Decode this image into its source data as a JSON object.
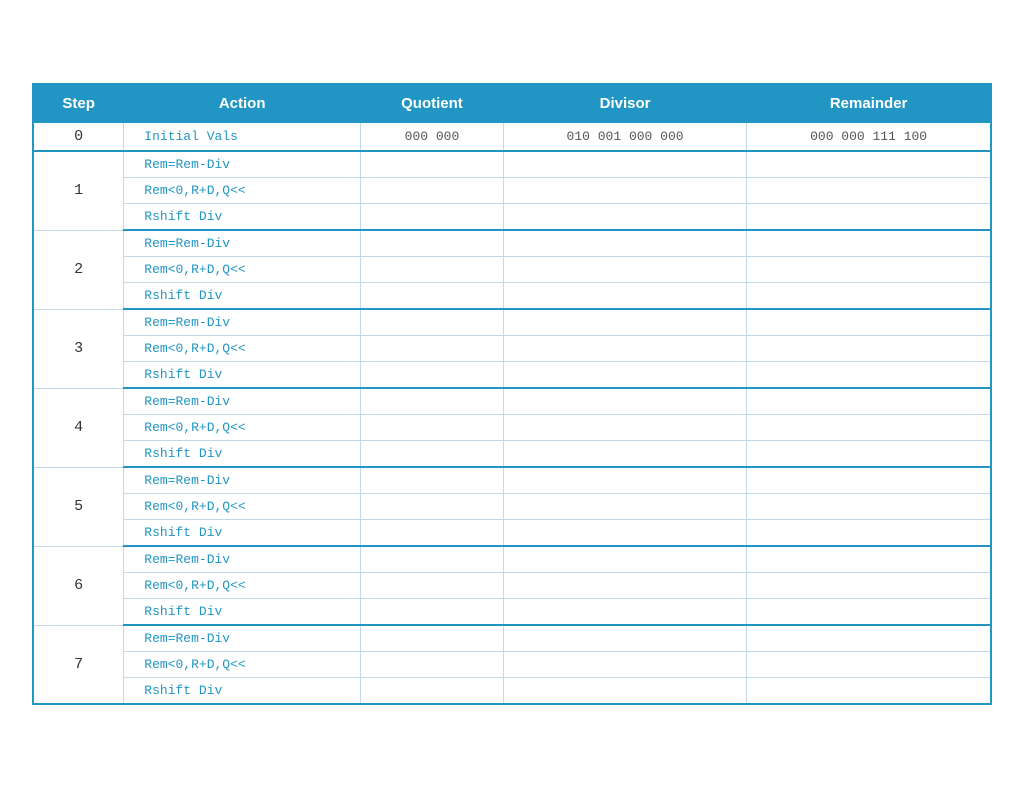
{
  "table": {
    "headers": [
      "Step",
      "Action",
      "Quotient",
      "Divisor",
      "Remainder"
    ],
    "step0": {
      "step": "0",
      "action": "Initial Vals",
      "quotient": "000 000",
      "divisor": "010 001 000 000",
      "remainder": "000 000 111 100"
    },
    "steps": [
      {
        "step": "1",
        "actions": [
          "Rem=Rem-Div",
          "Rem<0,R+D,Q<<",
          "Rshift Div"
        ]
      },
      {
        "step": "2",
        "actions": [
          "Rem=Rem-Div",
          "Rem<0,R+D,Q<<",
          "Rshift Div"
        ]
      },
      {
        "step": "3",
        "actions": [
          "Rem=Rem-Div",
          "Rem<0,R+D,Q<<",
          "Rshift Div"
        ]
      },
      {
        "step": "4",
        "actions": [
          "Rem=Rem-Div",
          "Rem<0,R+D,Q<<",
          "Rshift Div"
        ]
      },
      {
        "step": "5",
        "actions": [
          "Rem=Rem-Div",
          "Rem<0,R+D,Q<<",
          "Rshift Div"
        ]
      },
      {
        "step": "6",
        "actions": [
          "Rem=Rem-Div",
          "Rem<0,R+D,Q<<",
          "Rshift Div"
        ]
      },
      {
        "step": "7",
        "actions": [
          "Rem=Rem-Div",
          "Rem<0,R+D,Q<<",
          "Rshift Div"
        ]
      }
    ]
  }
}
